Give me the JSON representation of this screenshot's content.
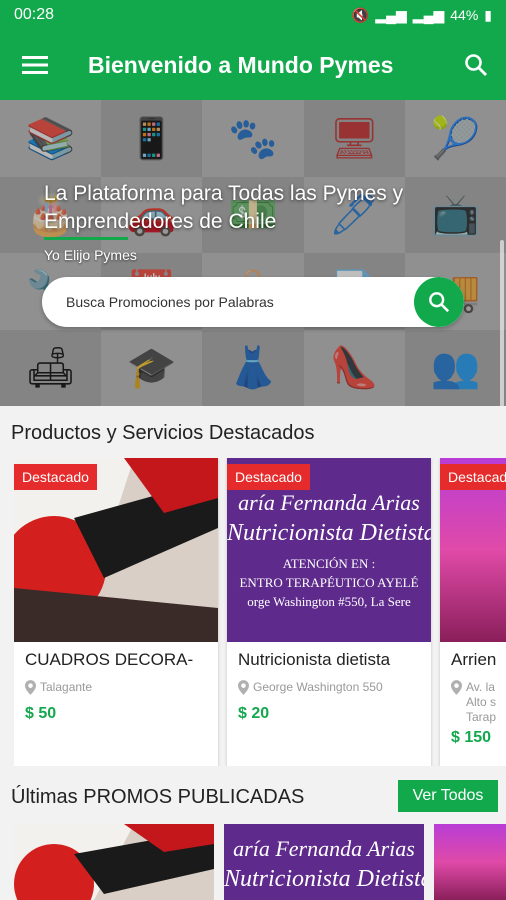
{
  "status": {
    "time": "00:28",
    "battery": "44%"
  },
  "app_bar": {
    "title": "Bienvenido a Mundo Pymes"
  },
  "hero": {
    "headline": "La Plataforma para Todas las Pymes y Emprendedores de Chile",
    "subtitle": "Yo Elijo Pymes",
    "search_placeholder": "Busca Promociones por Palabras"
  },
  "featured": {
    "title": "Productos y Servicios Destacados",
    "cards": [
      {
        "badge": "Destacado",
        "title": "CUADROS DECORA-",
        "location": "Talagante",
        "price": "$ 50"
      },
      {
        "badge": "Destacado",
        "title": "Nutricionista dietista",
        "location": "George Washington 550",
        "price": "$ 20"
      },
      {
        "badge": "Destacado",
        "title": "Arrien",
        "location": "Av. la Alto s Tarap",
        "price": "$ 150"
      }
    ]
  },
  "nutri_art": {
    "line1": "aría Fernanda Arias",
    "line2": "Nutricionista  Dietista",
    "line3": "ATENCIÓN EN :",
    "line4": "ENTRO TERAPÉUTICO AYELÉ",
    "line5": "orge Washington #550, La Sere"
  },
  "promos": {
    "title": "Últimas PROMOS PUBLICADAS",
    "see_all": "Ver Todos"
  }
}
